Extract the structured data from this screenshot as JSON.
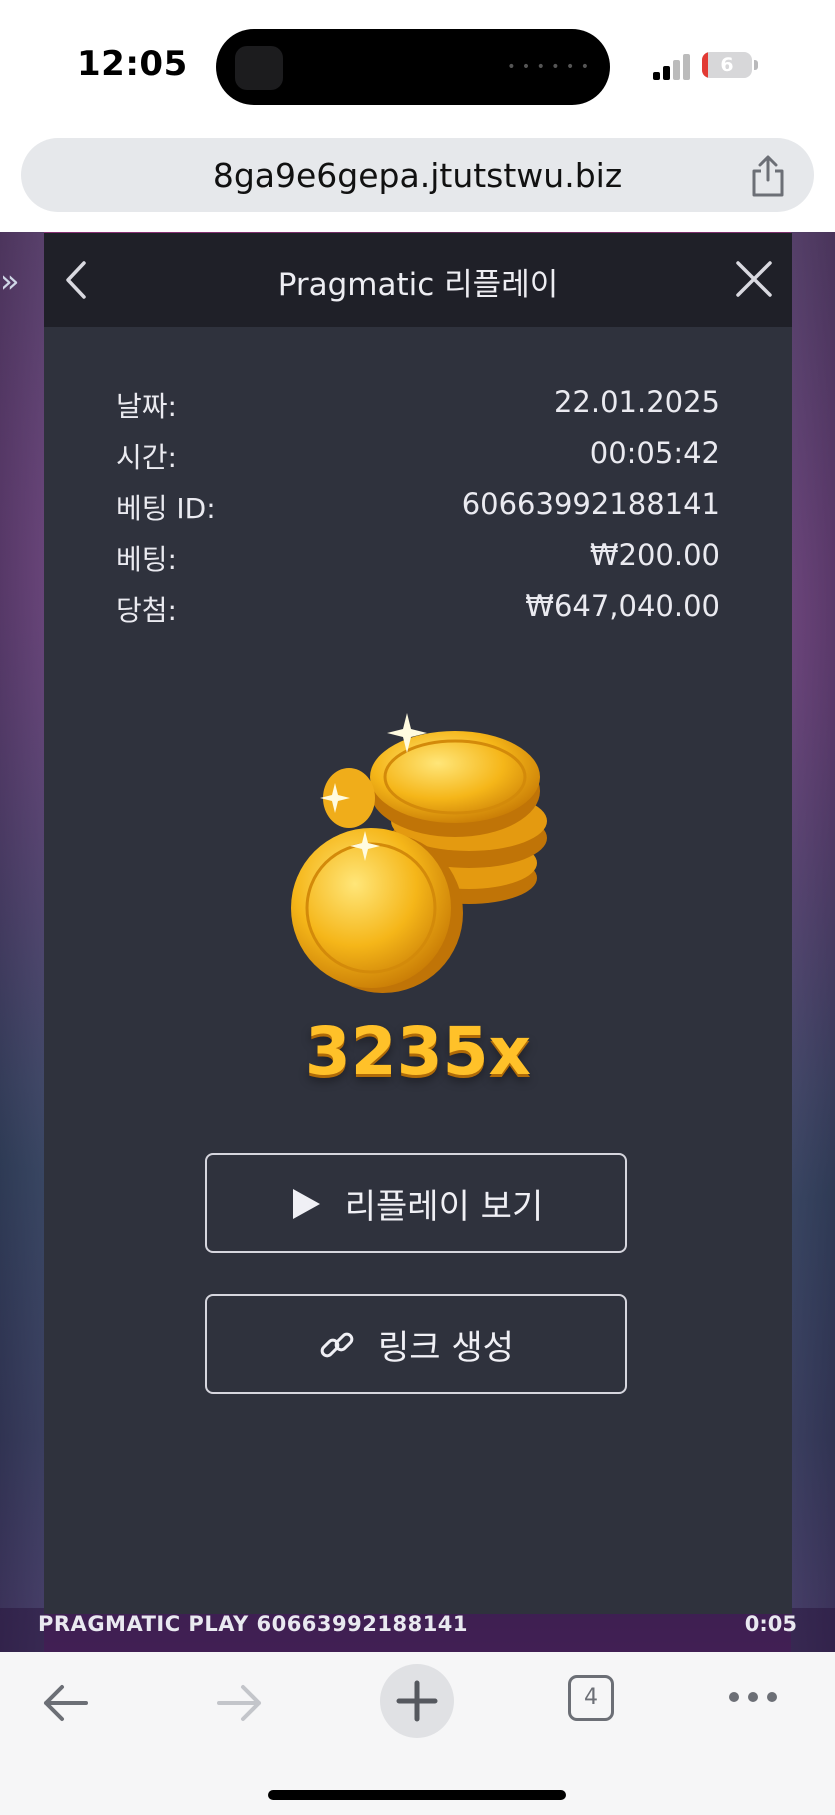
{
  "status_bar": {
    "time": "12:05",
    "battery": "6",
    "battery_level": 0.06
  },
  "browser": {
    "url": "8ga9e6gepa.jtutstwu.biz",
    "tab_count": "4"
  },
  "game": {
    "footer_left": "PRAGMATIC PLAY  60663992188141",
    "footer_right": "0:05"
  },
  "modal": {
    "title": "Pragmatic 리플레이",
    "rows": [
      {
        "label": "날짜:",
        "value": "22.01.2025"
      },
      {
        "label": "시간:",
        "value": "00:05:42"
      },
      {
        "label": "베팅 ID:",
        "value": "60663992188141"
      },
      {
        "label": "베팅:",
        "value": "₩200.00"
      },
      {
        "label": "당첨:",
        "value": "₩647,040.00"
      }
    ],
    "multiplier": "3235x",
    "replay_button": "리플레이 보기",
    "link_button": "링크 생성"
  },
  "colors": {
    "modal_bg": "#2f323d",
    "header_bg": "#1f2028",
    "multiplier": "#ffc129"
  },
  "icons": [
    "back-icon",
    "close-icon",
    "play-icon",
    "link-icon",
    "share-icon",
    "arrow-left-icon",
    "arrow-right-icon",
    "plus-icon",
    "more-icon",
    "coins-icon"
  ]
}
